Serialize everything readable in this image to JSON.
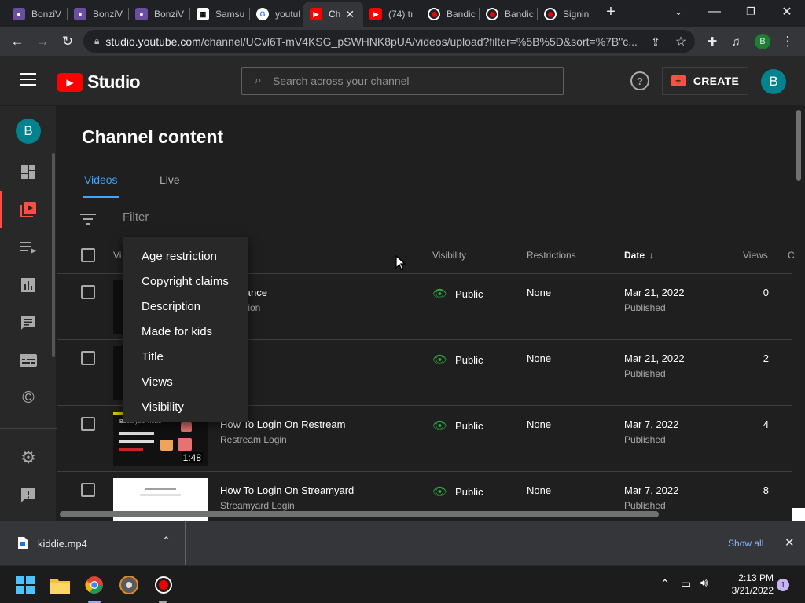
{
  "browser": {
    "tabs": [
      {
        "label": "BonziV",
        "icon": "bonzi-icon"
      },
      {
        "label": "BonziV",
        "icon": "bonzi-icon"
      },
      {
        "label": "BonziV",
        "icon": "bonzi-icon"
      },
      {
        "label": "Samsu",
        "icon": "qr-icon"
      },
      {
        "label": "youtul",
        "icon": "google-icon"
      },
      {
        "label": "Ch",
        "icon": "youtube-icon"
      },
      {
        "label": "(74) tı",
        "icon": "youtube-icon"
      },
      {
        "label": "Bandic",
        "icon": "record-icon"
      },
      {
        "label": "Bandic",
        "icon": "record-icon"
      },
      {
        "label": "Signin",
        "icon": "signin-icon"
      }
    ],
    "url_host": "studio.youtube.com",
    "url_path": "/channel/UCvl6T-mV4KSG_pSWHNK8pUA/videos/upload?filter=%5B%5D&sort=%7B\"c...",
    "profile_initial": "B"
  },
  "studio": {
    "logo_text": "Studio",
    "search_placeholder": "Search across your channel",
    "create_label": "CREATE",
    "avatar_initial": "B"
  },
  "sidebar": {
    "avatar_initial": "B",
    "items": [
      "dashboard-icon",
      "content-icon",
      "playlists-icon",
      "analytics-icon",
      "comments-icon",
      "subtitles-icon",
      "copyright-icon",
      "settings-icon",
      "feedback-icon"
    ]
  },
  "main": {
    "title": "Channel content",
    "tabs": [
      "Videos",
      "Live"
    ],
    "filter_placeholder": "Filter",
    "columns": {
      "video": "Vi",
      "visibility": "Visibility",
      "restrictions": "Restrictions",
      "date": "Date",
      "views": "Views",
      "comments": "C"
    },
    "rows": [
      {
        "title": "troll dance",
        "desc": "escription",
        "visibility": "Public",
        "restrictions": "None",
        "date": "Mar 21, 2022",
        "status": "Published",
        "views": "0"
      },
      {
        "title": "",
        "desc": "",
        "visibility": "Public",
        "restrictions": "None",
        "date": "Mar 21, 2022",
        "status": "Published",
        "views": "2"
      },
      {
        "title": "How To Login On Restream",
        "desc": "Restream Login",
        "visibility": "Public",
        "restrictions": "None",
        "date": "Mar 7, 2022",
        "status": "Published",
        "views": "4",
        "duration": "1:48",
        "thumb_text": "Boost your views"
      },
      {
        "title": "How To Login On Streamyard",
        "desc": "Streamyard Login",
        "visibility": "Public",
        "restrictions": "None",
        "date": "Mar 7, 2022",
        "status": "Published",
        "views": "8"
      }
    ],
    "filter_menu": [
      "Age restriction",
      "Copyright claims",
      "Description",
      "Made for kids",
      "Title",
      "Views",
      "Visibility"
    ]
  },
  "download": {
    "filename": "kiddie.mp4",
    "show_all": "Show all"
  },
  "taskbar": {
    "time": "2:13 PM",
    "date": "3/21/2022",
    "notification_count": "1"
  },
  "colors": {
    "accent_blue": "#3ea6ff",
    "youtube_red": "#ff0000",
    "public_green": "#2ba640",
    "avatar_teal": "#00838f"
  }
}
